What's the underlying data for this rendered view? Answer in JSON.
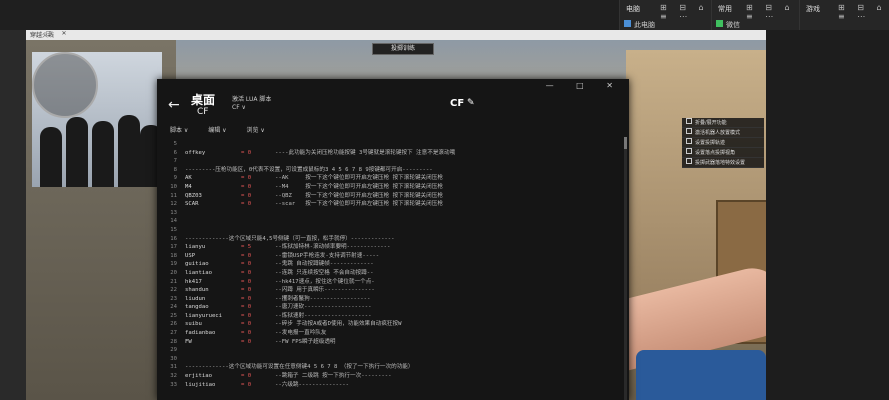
{
  "desktop": {
    "tiles": [
      {
        "name": "电脑",
        "ctrl": "⊞ ⊟ ⌂ ≡ ⋯",
        "item": "此电脑"
      },
      {
        "name": "常用",
        "ctrl": "⊞ ⊟ ⌂ ≡ ⋯",
        "item": "微信"
      },
      {
        "name": "游戏",
        "ctrl": "⊞ ⊟ ⌂ ≡ ⋯",
        "item": ""
      }
    ]
  },
  "game": {
    "window_title": "穿越火线",
    "window_ctrl": "— □ ✕",
    "top_banner": "投掷训练",
    "hud_menu": [
      "折叠/展开功能",
      "激活机器人放置模式",
      "设置投掷轨迹",
      "设置落点投掷视角",
      "投掷武器落地特效设置"
    ],
    "hud_side": "说明"
  },
  "editor": {
    "window_ctrl": "— □ ✕",
    "back_label": "←",
    "title": "桌面",
    "subtitle": "CF",
    "activate_label": "激活 LUA 脚本",
    "dropdown": "CF ∨",
    "script_name": "CF",
    "menu": [
      "脚本 ∨",
      "编辑 ∨",
      "浏览 ∨"
    ],
    "lines": [
      {
        "n": "5",
        "text": ""
      },
      {
        "n": "6",
        "key": "offkey",
        "val": "= 0",
        "cmt": "----此功能为关闭压枪功能按键 3号键就是滚轮键按下 注意不是滚动哦"
      },
      {
        "n": "7",
        "text": ""
      },
      {
        "n": "8",
        "text": "---------压枪功能区，0代表不设置，可设置成鼠标的3 4 5 6 7 8 9按键都可开启---------"
      },
      {
        "n": "9",
        "key": "AK",
        "val": "= 0",
        "cmt": "--AK     按一下这个键位即可开启左键压枪 按下滚轮键关闭压枪"
      },
      {
        "n": "10",
        "key": "M4",
        "val": "= 0",
        "cmt": "--M4     按一下这个键位即可开启左键压枪 按下滚轮键关闭压枪"
      },
      {
        "n": "11",
        "key": "QBZ03",
        "val": "= 0",
        "cmt": "--QBZ    按一下这个键位即可开启左键压枪 按下滚轮键关闭压枪"
      },
      {
        "n": "12",
        "key": "SCAR",
        "val": "= 0",
        "cmt": "--scar   按一下这个键位即可开启左键压枪 按下滚轮键关闭压枪"
      },
      {
        "n": "13",
        "text": ""
      },
      {
        "n": "14",
        "text": ""
      },
      {
        "n": "15",
        "text": ""
      },
      {
        "n": "16",
        "text": "-------------这个区域只能4,5号侧键（可一直按，松手就停）-------------"
      },
      {
        "n": "17",
        "key": "lianyu",
        "val": "= 5",
        "cmt": "--炼狱加特林-滚动帧率要明-------------"
      },
      {
        "n": "18",
        "key": "USP",
        "val": "= 0",
        "cmt": "--雷锁USP手枪连发-支持调节射速-----"
      },
      {
        "n": "19",
        "key": "guitiao",
        "val": "= 0",
        "cmt": "--鬼跳 自动按蹲键帧-------------"
      },
      {
        "n": "20",
        "key": "liantiao",
        "val": "= 0",
        "cmt": "--连跳 只连续按空格 不会自动按蹲--"
      },
      {
        "n": "21",
        "key": "hk417",
        "val": "= 0",
        "cmt": "--hk417速点，按住这个键位就一个点-"
      },
      {
        "n": "22",
        "key": "shandun",
        "val": "= 0",
        "cmt": "--闪蹲 用于真瞬乐---------------"
      },
      {
        "n": "23",
        "key": "liudun",
        "val": "= 0",
        "cmt": "--攫刺者鬣狗------------------"
      },
      {
        "n": "24",
        "key": "tangdao",
        "val": "= 0",
        "cmt": "--唐刀速砍--------------------"
      },
      {
        "n": "25",
        "key": "lianyurueci",
        "val": "= 0",
        "cmt": "--炼狱速射--------------------"
      },
      {
        "n": "26",
        "key": "suibu",
        "val": "= 0",
        "cmt": "--碎步 手动按A或者D使用，功能效果自动疯狂按W"
      },
      {
        "n": "27",
        "key": "fadianbao",
        "val": "= 0",
        "cmt": "--发电报一直吟队友"
      },
      {
        "n": "28",
        "key": "FW",
        "val": "= 0",
        "cmt": "--FW FPS瞬子超级透明"
      },
      {
        "n": "29",
        "text": ""
      },
      {
        "n": "30",
        "text": ""
      },
      {
        "n": "31",
        "text": "-------------这个区域功能可设置在任意侧键4 5 6 7 8 （按了一下执行一次的功能）"
      },
      {
        "n": "32",
        "key": "erjitiao",
        "val": "= 0",
        "cmt": "--跳箱子 二级跳 按一下执行一次---------"
      },
      {
        "n": "33",
        "key": "liujitiao",
        "val": "= 0",
        "cmt": "--六级跳---------------"
      }
    ]
  }
}
